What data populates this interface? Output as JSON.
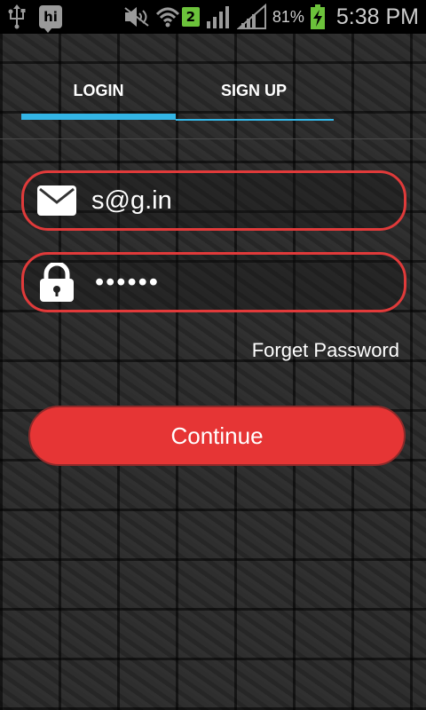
{
  "status_bar": {
    "usb_icon": "usb-icon",
    "app_icon_text": "hi",
    "sim_badge": "2",
    "battery_percent": "81%",
    "time": "5:38 PM"
  },
  "tabs": {
    "login_label": "LOGIN",
    "signup_label": "SIGN UP",
    "active": "login",
    "accent_color": "#33b5e5"
  },
  "form": {
    "email_icon": "envelope-icon",
    "email_value": "s@g.in",
    "password_icon": "lock-icon",
    "password_value": "••••••",
    "field_border_color": "#e03a3a"
  },
  "forget_password_label": "Forget Password",
  "continue_label": "Continue",
  "continue_color": "#e63535"
}
